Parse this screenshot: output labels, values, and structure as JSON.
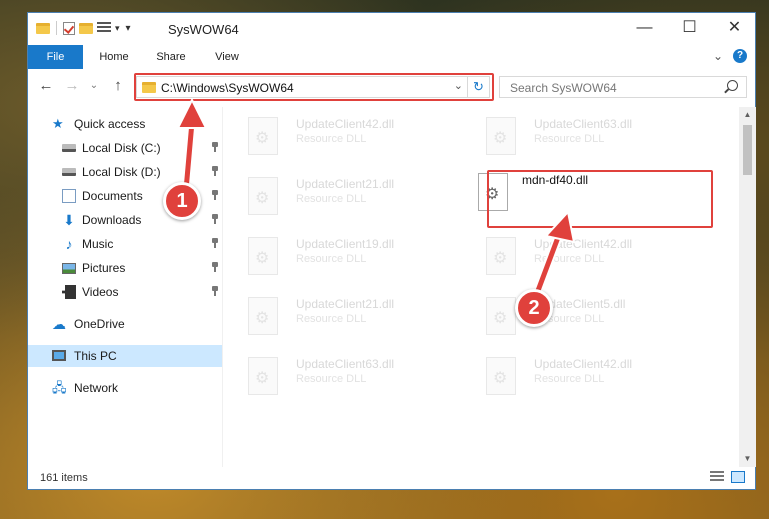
{
  "window": {
    "title": "SysWOW64",
    "controls": {
      "minimize": "—",
      "maximize": "☐",
      "close": "✕"
    }
  },
  "ribbon": {
    "tabs": [
      "File",
      "Home",
      "Share",
      "View"
    ],
    "expand": "⌄",
    "help": "?"
  },
  "nav": {
    "back": "←",
    "forward": "→",
    "recent": "⌄",
    "up": "↑"
  },
  "address": {
    "path": "C:\\Windows\\SysWOW64",
    "dropdown": "⌄",
    "refresh": "↻"
  },
  "search": {
    "placeholder": "Search SysWOW64"
  },
  "sidebar": {
    "items": [
      {
        "label": "Quick access",
        "icon": "star-icon",
        "pinned": false
      },
      {
        "label": "Local Disk (C:)",
        "icon": "drive-icon",
        "pinned": true
      },
      {
        "label": "Local Disk (D:)",
        "icon": "drive-icon",
        "pinned": true
      },
      {
        "label": "Documents",
        "icon": "documents-icon",
        "pinned": true
      },
      {
        "label": "Downloads",
        "icon": "downloads-icon",
        "pinned": true
      },
      {
        "label": "Music",
        "icon": "music-icon",
        "pinned": true
      },
      {
        "label": "Pictures",
        "icon": "pictures-icon",
        "pinned": true
      },
      {
        "label": "Videos",
        "icon": "videos-icon",
        "pinned": true
      },
      {
        "label": "OneDrive",
        "icon": "onedrive-icon",
        "pinned": false
      },
      {
        "label": "This PC",
        "icon": "this-pc-icon",
        "pinned": false,
        "selected": true
      },
      {
        "label": "Network",
        "icon": "network-icon",
        "pinned": false
      }
    ]
  },
  "files": {
    "left_column": [
      {
        "name": "UpdateClient42.dll",
        "type": "Resource DLL"
      },
      {
        "name": "UpdateClient21.dll",
        "type": "Resource DLL"
      },
      {
        "name": "UpdateClient19.dll",
        "type": "Resource DLL"
      },
      {
        "name": "UpdateClient21.dll",
        "type": "Resource DLL"
      },
      {
        "name": "UpdateClient63.dll",
        "type": "Resource DLL"
      }
    ],
    "right_column": [
      {
        "name": "UpdateClient63.dll",
        "type": "Resource DLL"
      },
      {
        "name": "mdn-df40.dll",
        "type": "",
        "active": true
      },
      {
        "name": "UpdateClient42.dll",
        "type": "Resource DLL"
      },
      {
        "name": "UpdateClient5.dll",
        "type": "Resource DLL"
      },
      {
        "name": "UpdateClient42.dll",
        "type": "Resource DLL"
      }
    ]
  },
  "status": {
    "item_count": "161 items"
  },
  "markers": {
    "step1": "1",
    "step2": "2"
  },
  "colors": {
    "accent": "#1979ca",
    "highlight": "#e0413c",
    "selected_bg": "#cce8ff"
  }
}
